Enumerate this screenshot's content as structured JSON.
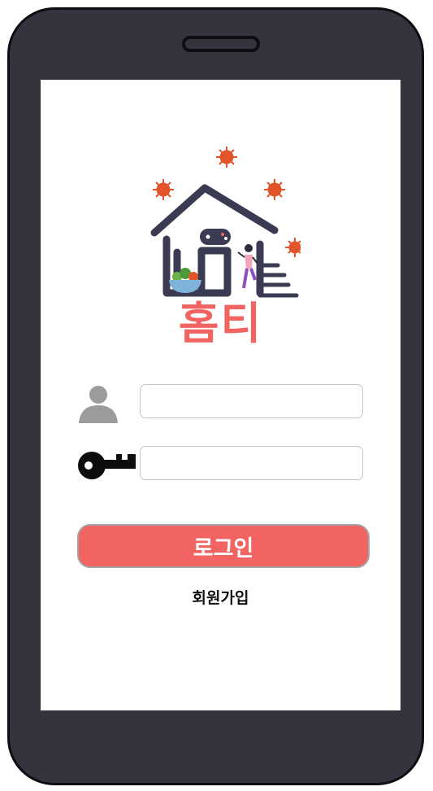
{
  "app": {
    "brand_name": "홈티"
  },
  "form": {
    "id_icon": "user-icon",
    "password_icon": "key-icon",
    "id_value": "",
    "password_value": "",
    "login_label": "로그인",
    "signup_label": "회원가입"
  },
  "colors": {
    "accent": "#f26461",
    "frame": "#34343f",
    "logo_navy": "#3a3b52",
    "virus": "#e2552a"
  }
}
